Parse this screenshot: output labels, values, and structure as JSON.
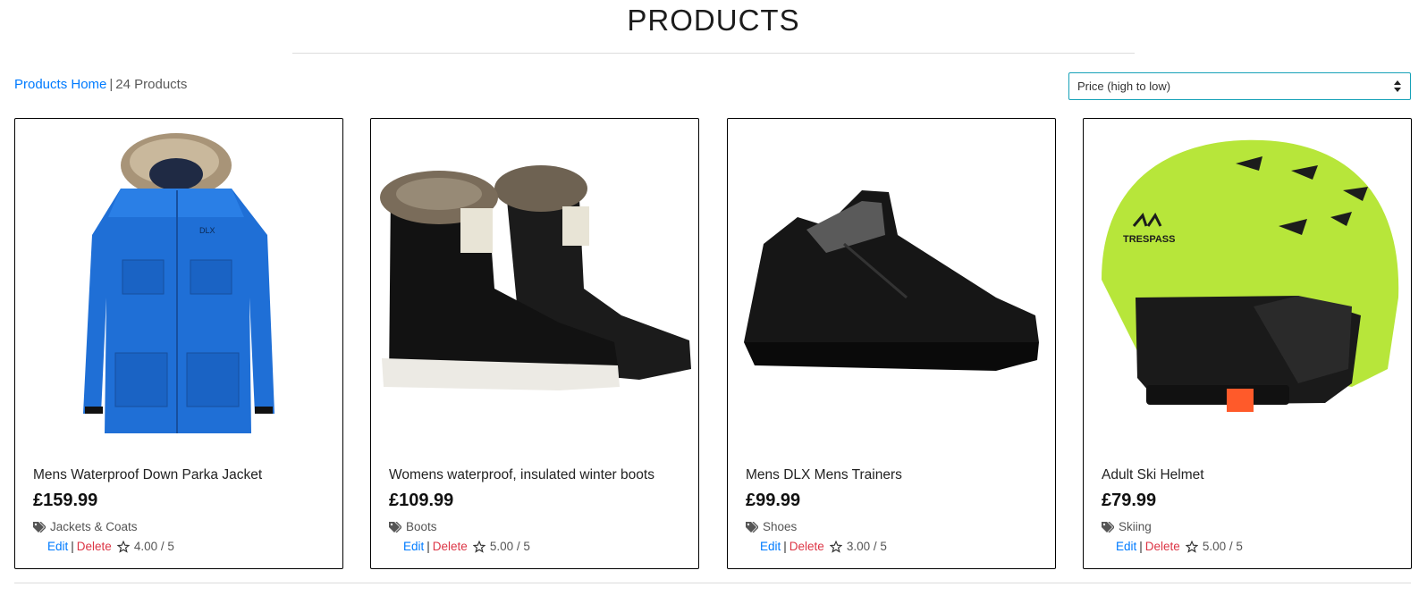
{
  "page": {
    "title": "PRODUCTS"
  },
  "toolbar": {
    "home_link": "Products Home",
    "separator": "|",
    "count_text": "24 Products",
    "sort_value": "Price (high to low)"
  },
  "products": [
    {
      "name": "Mens Waterproof Down Parka Jacket",
      "price": "£159.99",
      "category": "Jackets & Coats",
      "edit": "Edit",
      "delete": "Delete",
      "rating": "4.00 / 5"
    },
    {
      "name": "Womens waterproof, insulated winter boots",
      "price": "£109.99",
      "category": "Boots",
      "edit": "Edit",
      "delete": "Delete",
      "rating": "5.00 / 5"
    },
    {
      "name": "Mens DLX Mens Trainers",
      "price": "£99.99",
      "category": "Shoes",
      "edit": "Edit",
      "delete": "Delete",
      "rating": "3.00 / 5"
    },
    {
      "name": "Adult Ski Helmet",
      "price": "£79.99",
      "category": "Skiing",
      "edit": "Edit",
      "delete": "Delete",
      "rating": "5.00 / 5"
    }
  ],
  "colors": {
    "link": "#007bff",
    "danger": "#dc3545",
    "accent": "#17a2b8"
  }
}
